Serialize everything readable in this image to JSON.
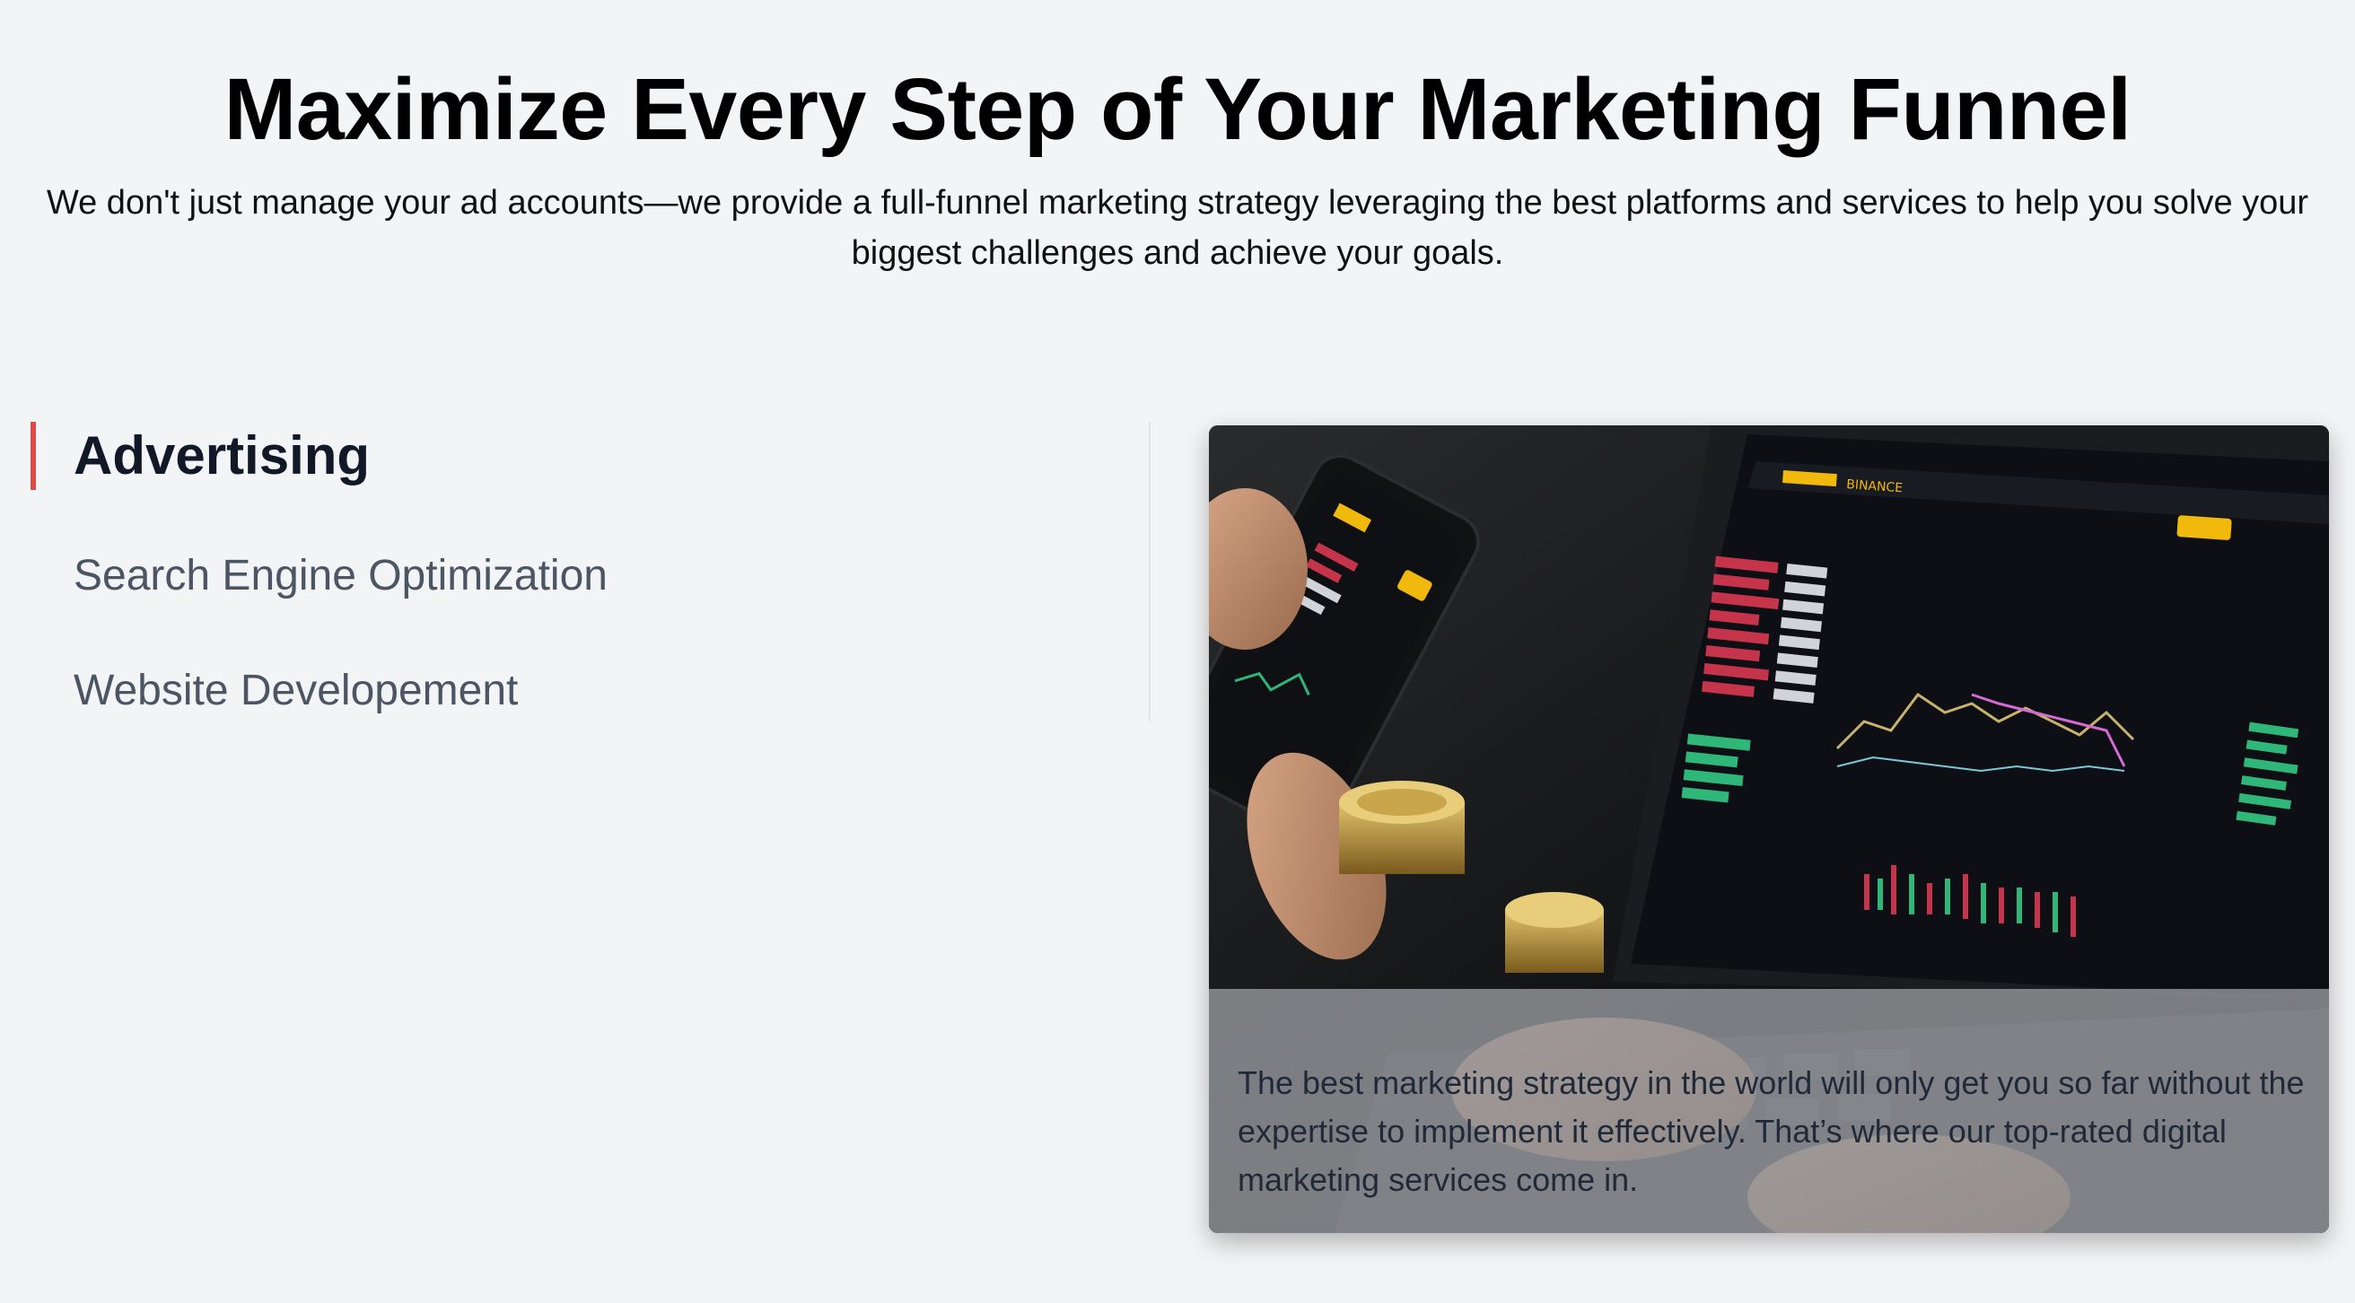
{
  "header": {
    "title": "Maximize Every Step of Your Marketing Funnel",
    "subtitle": "We don't just manage your ad accounts—we provide a full-funnel marketing strategy leveraging the best platforms and services to help you solve your biggest challenges and achieve your goals."
  },
  "tabs": [
    {
      "label": "Advertising",
      "active": true
    },
    {
      "label": "Search Engine Optimization",
      "active": false
    },
    {
      "label": "Website Developement",
      "active": false
    }
  ],
  "card": {
    "caption": "The best marketing strategy in the world will only get you so far without the expertise to implement it effectively. That’s where our top-rated digital marketing services come in.",
    "photo_subject": "hands holding phone and laptop showing crypto trading charts with gold coins",
    "screen_brand": "BINANCE"
  },
  "colors": {
    "background": "#f3f4f6",
    "active_indicator": "#dc4a4a",
    "active_tab_text": "#111827",
    "idle_tab_text": "#4b5563"
  }
}
